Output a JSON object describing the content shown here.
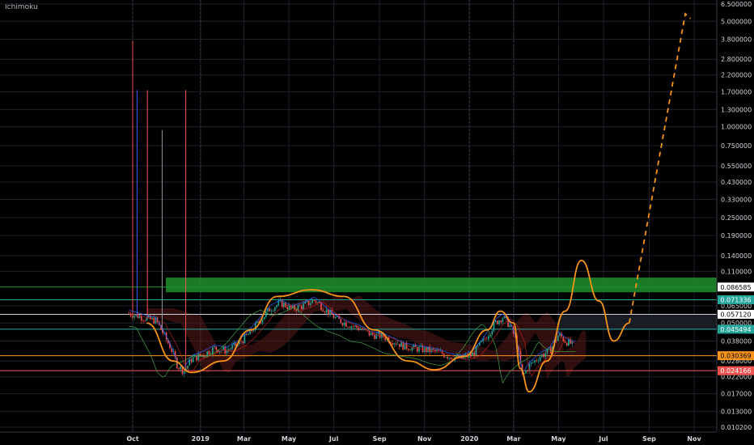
{
  "indicator": {
    "title": "Ichimoku"
  },
  "colors": {
    "background": "#000000",
    "grid": "#1e222d",
    "axis_text": "#d1d4dc",
    "bull": "#26a69a",
    "bear": "#ef5350",
    "pattern": "#f7931a",
    "zone": "#1e8f2e",
    "kumo_bear": "#5a1a1a",
    "kumo_bull": "#1b4d20"
  },
  "chart_data": {
    "type": "line",
    "title": "",
    "xlabel": "",
    "ylabel": "",
    "yscale": "log",
    "ylim": [
      0.0093,
      6.8
    ],
    "y_ticks": [
      "6.500000",
      "5.000000",
      "3.800000",
      "2.800000",
      "2.200000",
      "1.700000",
      "1.300000",
      "1.000000",
      "0.750000",
      "0.550000",
      "0.430000",
      "0.330000",
      "0.250000",
      "0.190000",
      "0.140000",
      "0.110000",
      "0.086585",
      "0.071336",
      "0.065000",
      "0.057120",
      "0.050000",
      "0.045494",
      "0.038000",
      "0.030369",
      "0.028000",
      "0.024166",
      "0.022000",
      "0.017000",
      "0.013000",
      "0.010200"
    ],
    "x_ticks": [
      {
        "label": "Oct",
        "date": "2018-10-01"
      },
      {
        "label": "2019",
        "date": "2019-01-01"
      },
      {
        "label": "Mar",
        "date": "2019-03-01"
      },
      {
        "label": "May",
        "date": "2019-05-01"
      },
      {
        "label": "Jul",
        "date": "2019-07-01"
      },
      {
        "label": "Sep",
        "date": "2019-09-01"
      },
      {
        "label": "Nov",
        "date": "2019-11-01"
      },
      {
        "label": "2020",
        "date": "2020-01-01"
      },
      {
        "label": "Mar",
        "date": "2020-03-01"
      },
      {
        "label": "May",
        "date": "2020-05-01"
      },
      {
        "label": "Jul",
        "date": "2020-07-01"
      },
      {
        "label": "Sep",
        "date": "2020-09-01"
      },
      {
        "label": "Nov",
        "date": "2020-11-01"
      }
    ],
    "price_levels": [
      {
        "value": 0.086585,
        "label": "0.086585",
        "color": "#1e8f2e",
        "badge_bg": "#ffffff",
        "badge_fg": "#000000"
      },
      {
        "value": 0.071336,
        "label": "0.071336",
        "color": "#26a69a",
        "badge_bg": "#26a69a",
        "badge_fg": "#ffffff"
      },
      {
        "value": 0.05712,
        "label": "0.057120",
        "color": "#d1d4dc",
        "badge_bg": "#ffffff",
        "badge_fg": "#000000"
      },
      {
        "value": 0.045494,
        "label": "0.045494",
        "color": "#26a69a",
        "badge_bg": "#26a69a",
        "badge_fg": "#ffffff"
      },
      {
        "value": 0.030369,
        "label": "0.030369",
        "color": "#f7931a",
        "badge_bg": "#f7931a",
        "badge_fg": "#000000"
      },
      {
        "value": 0.024166,
        "label": "0.024166",
        "color": "#ef5350",
        "badge_bg": "#ef5350",
        "badge_fg": "#ffffff"
      }
    ],
    "resistance_zone": {
      "from_date": "2018-11-15",
      "to_date": "2020-12-05",
      "low": 0.08,
      "high": 0.1
    },
    "spikes": [
      {
        "date": "2018-10-01",
        "high": 3.7,
        "color": "#ef5350"
      },
      {
        "date": "2018-10-07",
        "high": 1.75,
        "color": "#2962ff"
      },
      {
        "date": "2018-10-21",
        "high": 1.75,
        "color": "#ef5350"
      },
      {
        "date": "2018-11-10",
        "high": 0.95,
        "color": "#9598a1"
      },
      {
        "date": "2018-12-12",
        "high": 1.75,
        "color": "#ef5350"
      }
    ],
    "series": [
      {
        "name": "",
        "points": [
          [
            "2018-09-26",
            0.058
          ],
          [
            "2018-10-01",
            0.057
          ],
          [
            "2018-10-12",
            0.055
          ],
          [
            "2018-10-22",
            0.053
          ],
          [
            "2018-11-02",
            0.052
          ],
          [
            "2018-11-12",
            0.042
          ],
          [
            "2018-11-22",
            0.034
          ],
          [
            "2018-12-01",
            0.026
          ],
          [
            "2018-12-10",
            0.024
          ],
          [
            "2018-12-20",
            0.029
          ],
          [
            "2019-01-05",
            0.031
          ],
          [
            "2019-01-20",
            0.034
          ],
          [
            "2019-02-05",
            0.033
          ],
          [
            "2019-02-20",
            0.036
          ],
          [
            "2019-03-05",
            0.041
          ],
          [
            "2019-03-20",
            0.05
          ],
          [
            "2019-04-05",
            0.062
          ],
          [
            "2019-04-20",
            0.068
          ],
          [
            "2019-05-05",
            0.062
          ],
          [
            "2019-05-20",
            0.065
          ],
          [
            "2019-06-05",
            0.071
          ],
          [
            "2019-06-20",
            0.061
          ],
          [
            "2019-07-05",
            0.053
          ],
          [
            "2019-07-20",
            0.049
          ],
          [
            "2019-08-05",
            0.046
          ],
          [
            "2019-08-20",
            0.042
          ],
          [
            "2019-09-05",
            0.041
          ],
          [
            "2019-09-20",
            0.038
          ],
          [
            "2019-10-05",
            0.035
          ],
          [
            "2019-10-20",
            0.034
          ],
          [
            "2019-11-05",
            0.033
          ],
          [
            "2019-11-20",
            0.032
          ],
          [
            "2019-12-05",
            0.03
          ],
          [
            "2019-12-20",
            0.029
          ],
          [
            "2020-01-05",
            0.031
          ],
          [
            "2020-01-20",
            0.038
          ],
          [
            "2020-02-05",
            0.05
          ],
          [
            "2020-02-15",
            0.055
          ],
          [
            "2020-02-25",
            0.048
          ],
          [
            "2020-03-05",
            0.038
          ],
          [
            "2020-03-13",
            0.022
          ],
          [
            "2020-03-22",
            0.026
          ],
          [
            "2020-04-05",
            0.03
          ],
          [
            "2020-04-20",
            0.033
          ],
          [
            "2020-05-01",
            0.042
          ],
          [
            "2020-05-10",
            0.038
          ],
          [
            "2020-05-20",
            0.036
          ]
        ]
      }
    ]
  }
}
